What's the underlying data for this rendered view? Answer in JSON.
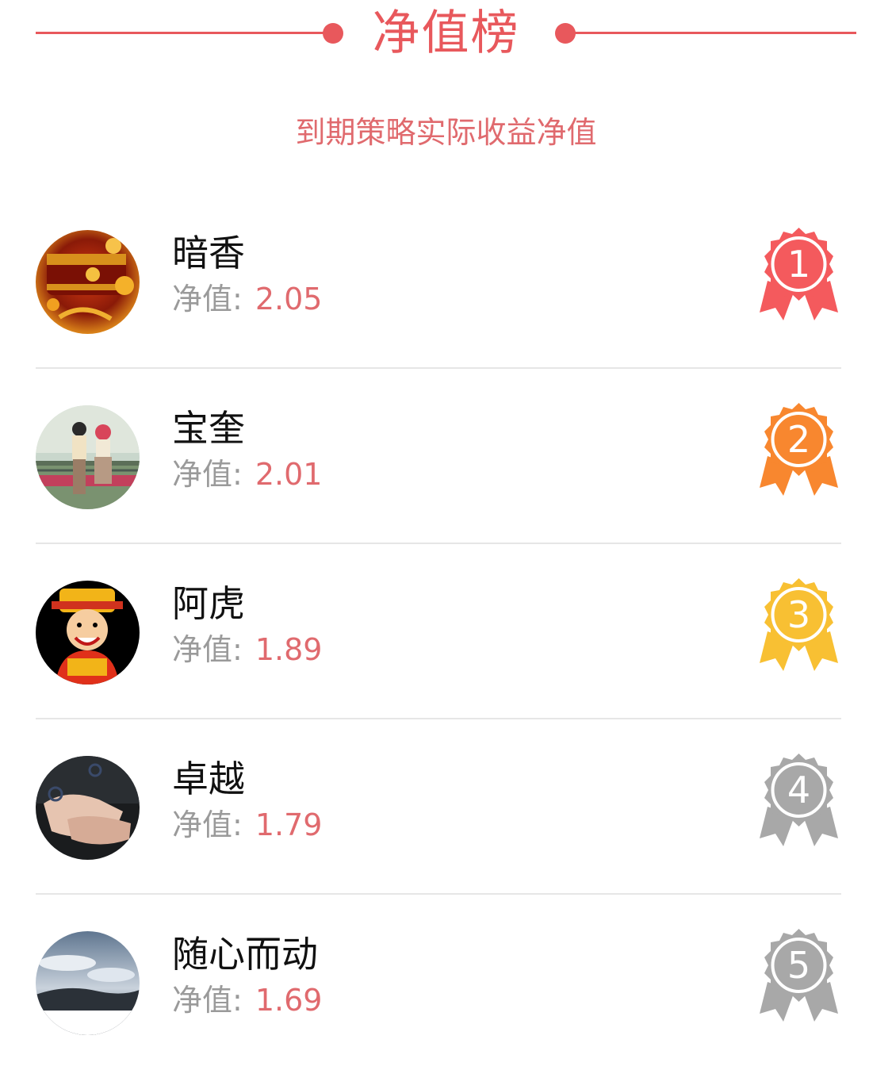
{
  "header": {
    "title": "净值榜",
    "subtitle": "到期策略实际收益净值",
    "accent_color": "#e8585c"
  },
  "nav_label": "净值:",
  "ranking": [
    {
      "rank": "1",
      "name": "暗香",
      "nav": "2.05",
      "badge_color": "#f45a5d",
      "avatar_icon": "jewelry-box-avatar"
    },
    {
      "rank": "2",
      "name": "宝奎",
      "nav": "2.01",
      "badge_color": "#f8872f",
      "avatar_icon": "anime-couple-avatar"
    },
    {
      "rank": "3",
      "name": "阿虎",
      "nav": "1.89",
      "badge_color": "#f8c033",
      "avatar_icon": "fortune-god-avatar"
    },
    {
      "rank": "4",
      "name": "卓越",
      "nav": "1.79",
      "badge_color": "#a8a8a8",
      "avatar_icon": "holding-hands-avatar"
    },
    {
      "rank": "5",
      "name": "随心而动",
      "nav": "1.69",
      "badge_color": "#a8a8a8",
      "avatar_icon": "cloudy-sky-avatar"
    }
  ]
}
